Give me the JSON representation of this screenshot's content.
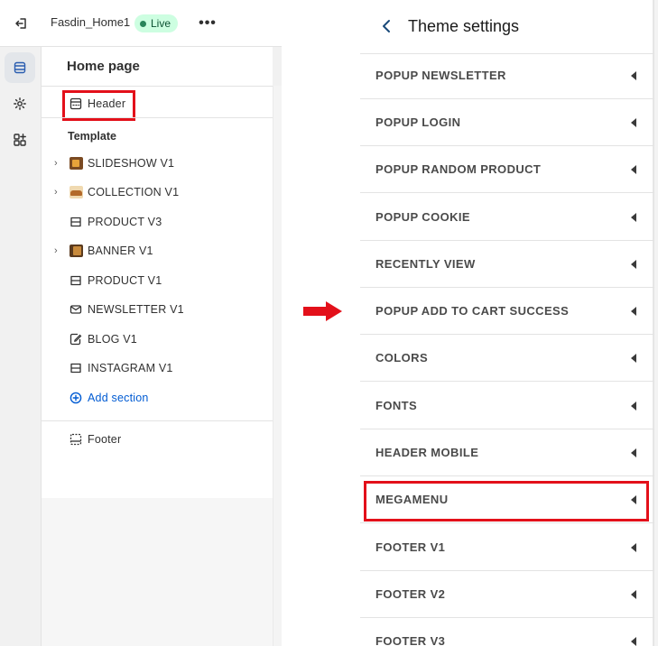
{
  "left_panel": {
    "theme_name": "Fasdin_Home1",
    "live_label": "Live",
    "more_label": "•••",
    "page_title": "Home page",
    "header_label": "Header",
    "template_label": "Template",
    "template_items": [
      {
        "label": "SLIDESHOW V1",
        "icon": "slideshow-image-icon",
        "expandable": true
      },
      {
        "label": "COLLECTION V1",
        "icon": "collection-image-icon",
        "expandable": true
      },
      {
        "label": "PRODUCT V3",
        "icon": "section-icon",
        "expandable": false
      },
      {
        "label": "BANNER V1",
        "icon": "banner-image-icon",
        "expandable": true
      },
      {
        "label": "PRODUCT V1",
        "icon": "section-icon",
        "expandable": false
      },
      {
        "label": "NEWSLETTER V1",
        "icon": "envelope-icon",
        "expandable": false
      },
      {
        "label": "BLOG V1",
        "icon": "blog-edit-icon",
        "expandable": false
      },
      {
        "label": "INSTAGRAM V1",
        "icon": "section-icon",
        "expandable": false
      }
    ],
    "add_section_label": "Add section",
    "footer_label": "Footer",
    "rail": [
      "sections-icon",
      "gear-icon",
      "apps-icon"
    ]
  },
  "right_panel": {
    "title": "Theme settings",
    "items": [
      {
        "label": "POPUP NEWSLETTER"
      },
      {
        "label": "POPUP LOGIN"
      },
      {
        "label": "POPUP RANDOM PRODUCT"
      },
      {
        "label": "POPUP COOKIE"
      },
      {
        "label": "RECENTLY VIEW"
      },
      {
        "label": "POPUP ADD TO CART SUCCESS"
      },
      {
        "label": "COLORS"
      },
      {
        "label": "FONTS"
      },
      {
        "label": "HEADER MOBILE"
      },
      {
        "label": "MEGAMENU"
      },
      {
        "label": "FOOTER V1"
      },
      {
        "label": "FOOTER V2"
      },
      {
        "label": "FOOTER V3"
      }
    ]
  },
  "colors": {
    "highlight": "#e3101a",
    "arrow": "#e3101a",
    "live_badge_bg": "#cdfee1",
    "link_blue": "#005bd3"
  }
}
